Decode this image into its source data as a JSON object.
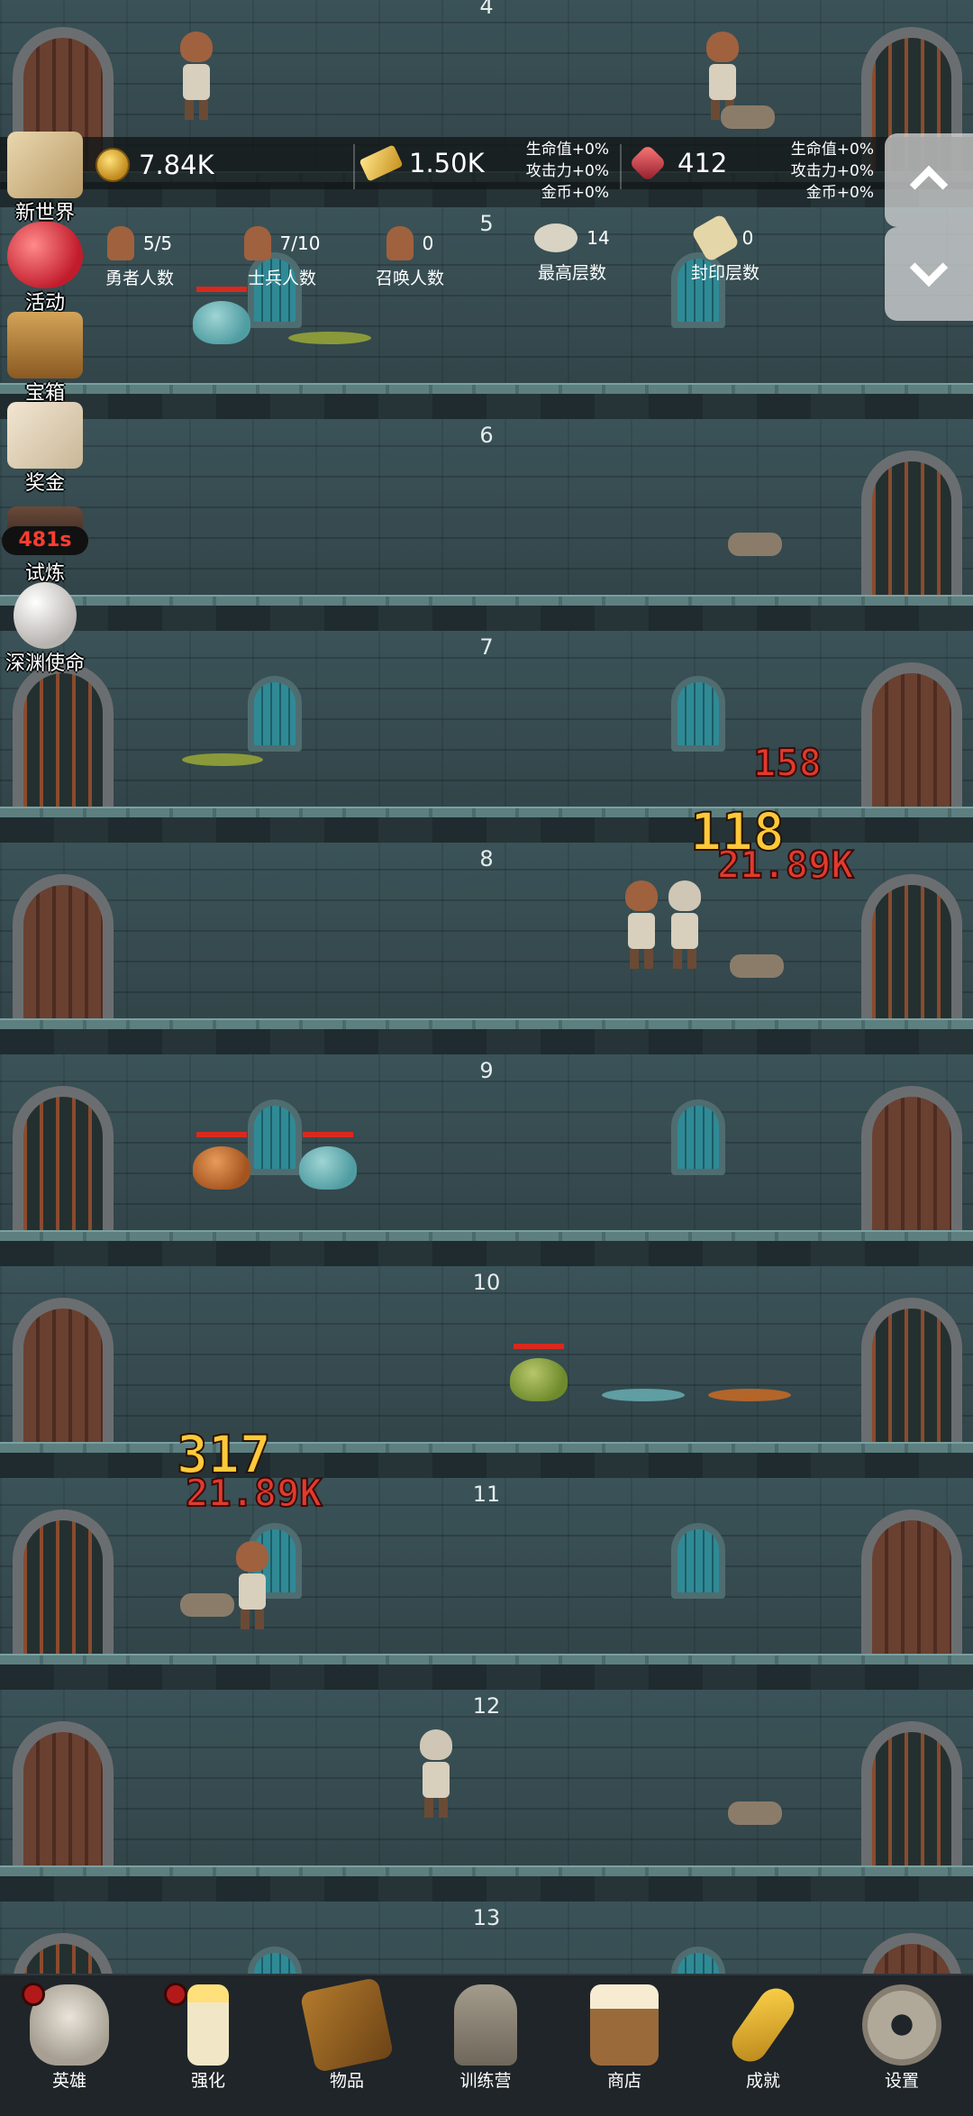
{
  "floors": [
    {
      "number": "4"
    },
    {
      "number": "5"
    },
    {
      "number": "6"
    },
    {
      "number": "7"
    },
    {
      "number": "8"
    },
    {
      "number": "9"
    },
    {
      "number": "10"
    },
    {
      "number": "11"
    },
    {
      "number": "12"
    },
    {
      "number": "13"
    }
  ],
  "resources": {
    "coins": "7.84K",
    "gold_bars": "1.50K",
    "gems": "412"
  },
  "bonus_left": {
    "hp": "生命值+0%",
    "atk": "攻击力+0%",
    "coin": "金币+0%"
  },
  "bonus_right": {
    "hp": "生命值+0%",
    "atk": "攻击力+0%",
    "coin": "金币+0%"
  },
  "stats": {
    "heroes": {
      "value": "5/5",
      "label": "勇者人数"
    },
    "soldiers": {
      "value": "7/10",
      "label": "士兵人数"
    },
    "summons": {
      "value": "0",
      "label": "召唤人数"
    },
    "highest": {
      "value": "14",
      "label": "最高层数"
    },
    "sealed": {
      "value": "0",
      "label": "封印层数"
    }
  },
  "left_menu": {
    "new_world": "新世界",
    "event": "活动",
    "chest": "宝箱",
    "reward": "奖金",
    "trial": "试炼",
    "trial_timer": "481s",
    "abyss": "深渊使命"
  },
  "damage_numbers": {
    "floor7_red": "158",
    "floor8_gold": "118",
    "floor8_red": "21.89K",
    "floor11_gold": "317",
    "floor11_red": "21.89K"
  },
  "nav": {
    "hero": "英雄",
    "upgrade": "强化",
    "items": "物品",
    "training": "训练营",
    "shop": "商店",
    "achievements": "成就",
    "settings": "设置"
  },
  "colors": {
    "damage_red": "#e23a2d",
    "damage_gold": "#ffc93a",
    "badge_red": "#b21a1a"
  }
}
